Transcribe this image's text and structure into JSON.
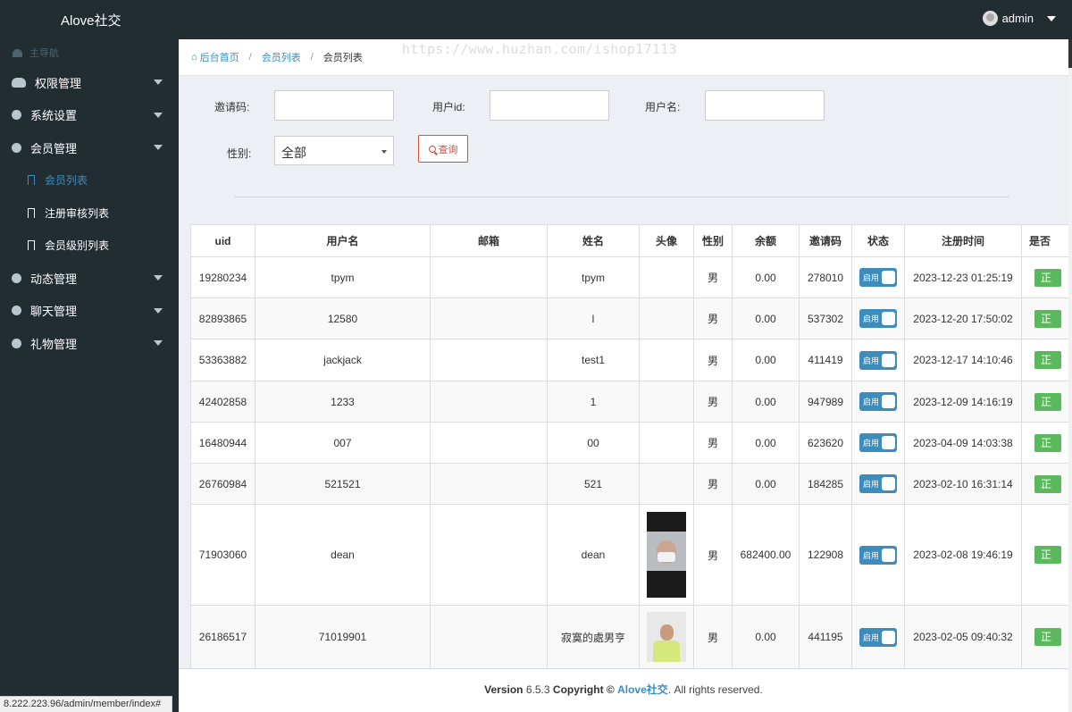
{
  "app": {
    "title": "Alove社交",
    "user": "admin"
  },
  "sidebar": {
    "header": "主导航",
    "menus": [
      {
        "label": "权限管理"
      },
      {
        "label": "系统设置"
      },
      {
        "label": "会员管理",
        "subs": [
          {
            "label": "会员列表",
            "active": true
          },
          {
            "label": "注册审核列表"
          },
          {
            "label": "会员级别列表"
          }
        ]
      },
      {
        "label": "动态管理"
      },
      {
        "label": "聊天管理"
      },
      {
        "label": "礼物管理"
      }
    ]
  },
  "status_url": "8.222.223.96/admin/member/index#",
  "watermark": "https://www.huzhan.com/ishop17113",
  "breadcrumb": {
    "home": "后台首页",
    "list": "会员列表",
    "current": "会员列表"
  },
  "filters": {
    "invite_label": "邀请码:",
    "uid_label": "用户id:",
    "username_label": "用户名:",
    "gender_label": "性别:",
    "gender_value": "全部",
    "query_button": "查询"
  },
  "table": {
    "columns": [
      "uid",
      "用户名",
      "邮箱",
      "姓名",
      "头像",
      "性别",
      "余额",
      "邀请码",
      "状态",
      "注册时间",
      "是否"
    ],
    "status_label": "启用",
    "tag_label": "正",
    "rows": [
      {
        "uid": "19280234",
        "username": "tpym",
        "email": "",
        "name": "tpym",
        "gender": "男",
        "balance": "0.00",
        "invite": "278010",
        "time": "2023-12-23 01:25:19"
      },
      {
        "uid": "82893865",
        "username": "12580",
        "email": "",
        "name": "l",
        "gender": "男",
        "balance": "0.00",
        "invite": "537302",
        "time": "2023-12-20 17:50:02"
      },
      {
        "uid": "53363882",
        "username": "jackjack",
        "email": "",
        "name": "test1",
        "gender": "男",
        "balance": "0.00",
        "invite": "411419",
        "time": "2023-12-17 14:10:46"
      },
      {
        "uid": "42402858",
        "username": "1233",
        "email": "",
        "name": "1",
        "gender": "男",
        "balance": "0.00",
        "invite": "947989",
        "time": "2023-12-09 14:16:19"
      },
      {
        "uid": "16480944",
        "username": "007",
        "email": "",
        "name": "00",
        "gender": "男",
        "balance": "0.00",
        "invite": "623620",
        "time": "2023-04-09 14:03:38"
      },
      {
        "uid": "26760984",
        "username": "521521",
        "email": "",
        "name": "521",
        "gender": "男",
        "balance": "0.00",
        "invite": "184285",
        "time": "2023-02-10 16:31:14"
      },
      {
        "uid": "71903060",
        "username": "dean",
        "email": "",
        "name": "dean",
        "gender": "男",
        "balance": "682400.00",
        "invite": "122908",
        "time": "2023-02-08 19:46:19"
      },
      {
        "uid": "26186517",
        "username": "71019901",
        "email": "",
        "name": "寂寞的處男亨",
        "gender": "男",
        "balance": "0.00",
        "invite": "441195",
        "time": "2023-02-05 09:40:32"
      }
    ]
  },
  "footer": {
    "version_label": "Version",
    "version": "6.5.3",
    "copyright": "Copyright ©",
    "brand": "Alove社交",
    "rest": ". All rights reserved."
  }
}
